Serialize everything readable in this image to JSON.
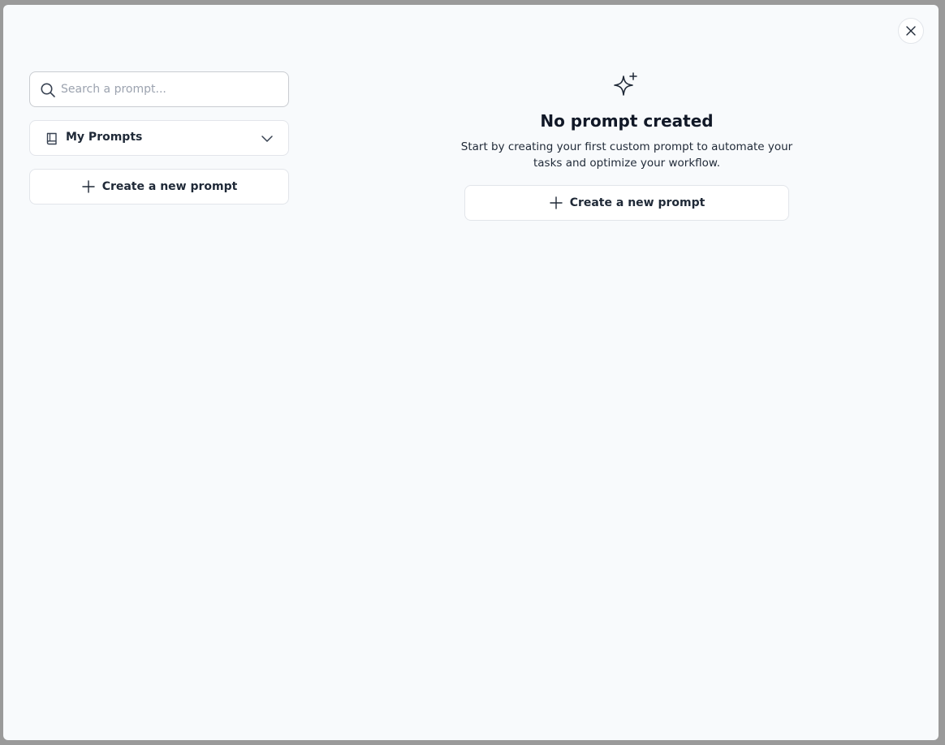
{
  "sidebar": {
    "search": {
      "placeholder": "Search a prompt...",
      "value": ""
    },
    "dropdown": {
      "selected": "My Prompts"
    },
    "create_button_label": "Create a new prompt"
  },
  "main": {
    "empty_state": {
      "icon": "sparkles-icon",
      "title": "No prompt created",
      "description": "Start by creating your first custom prompt to automate your tasks and optimize your workflow.",
      "create_button_label": "Create a new prompt"
    }
  },
  "icons": {
    "close": "close-icon",
    "search": "search-icon",
    "book": "book-icon",
    "chevron": "chevron-down-icon",
    "plus": "plus-icon"
  },
  "colors": {
    "background": "#f8fafc",
    "border": "#e2e5ea",
    "text": "#1f2937"
  }
}
